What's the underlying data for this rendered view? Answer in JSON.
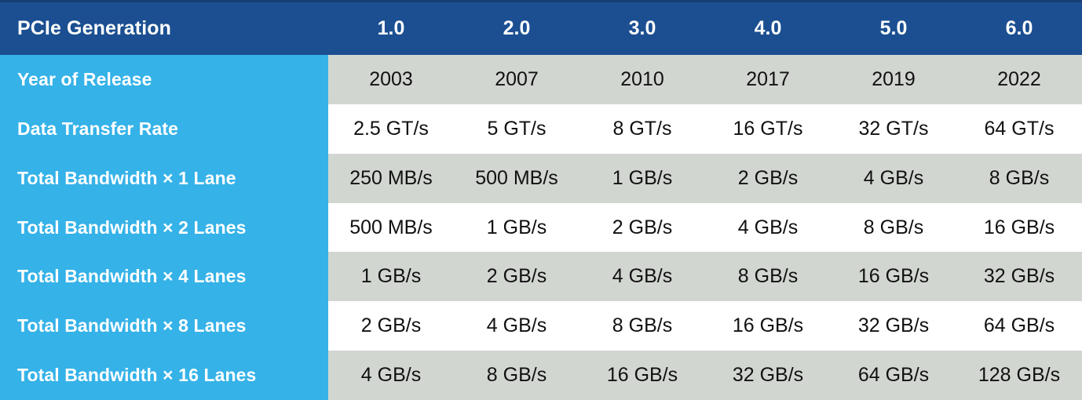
{
  "table": {
    "header": {
      "row_label": "PCIe Generation",
      "columns": [
        "1.0",
        "2.0",
        "3.0",
        "4.0",
        "5.0",
        "6.0"
      ]
    },
    "row_labels": [
      "Year of Release",
      "Data Transfer Rate",
      "Total Bandwidth × 1 Lane",
      "Total Bandwidth × 2 Lanes",
      "Total Bandwidth × 4 Lanes",
      "Total Bandwidth × 8 Lanes",
      "Total Bandwidth × 16 Lanes"
    ],
    "rows": [
      {
        "label": "Year of Release",
        "banded": true,
        "values": [
          "2003",
          "2007",
          "2010",
          "2017",
          "2019",
          "2022"
        ]
      },
      {
        "label": "Data Transfer Rate",
        "banded": false,
        "values": [
          "2.5 GT/s",
          "5 GT/s",
          "8 GT/s",
          "16 GT/s",
          "32 GT/s",
          "64 GT/s"
        ]
      },
      {
        "label": "Total Bandwidth × 1 Lane",
        "banded": true,
        "values": [
          "250 MB/s",
          "500 MB/s",
          "1 GB/s",
          "2 GB/s",
          "4 GB/s",
          "8 GB/s"
        ]
      },
      {
        "label": "Total Bandwidth × 2 Lanes",
        "banded": false,
        "values": [
          "500 MB/s",
          "1 GB/s",
          "2 GB/s",
          "4 GB/s",
          "8 GB/s",
          "16 GB/s"
        ]
      },
      {
        "label": "Total Bandwidth × 4 Lanes",
        "banded": true,
        "values": [
          "1 GB/s",
          "2 GB/s",
          "4 GB/s",
          "8 GB/s",
          "16 GB/s",
          "32 GB/s"
        ]
      },
      {
        "label": "Total Bandwidth × 8 Lanes",
        "banded": false,
        "values": [
          "2 GB/s",
          "4 GB/s",
          "8 GB/s",
          "16 GB/s",
          "32 GB/s",
          "64 GB/s"
        ]
      },
      {
        "label": "Total Bandwidth × 16 Lanes",
        "banded": true,
        "values": [
          "4 GB/s",
          "8 GB/s",
          "16 GB/s",
          "32 GB/s",
          "64 GB/s",
          "128 GB/s"
        ]
      }
    ]
  },
  "colors": {
    "header_blue": "#1B4F91",
    "header_blue_top": "#173F74",
    "label_blue": "#35B2E8",
    "band_gray": "#D2D6D1",
    "row_white": "#FFFFFF",
    "header_text": "#FFFFFF",
    "label_text": "#FFFFFF",
    "data_text": "#111111"
  }
}
